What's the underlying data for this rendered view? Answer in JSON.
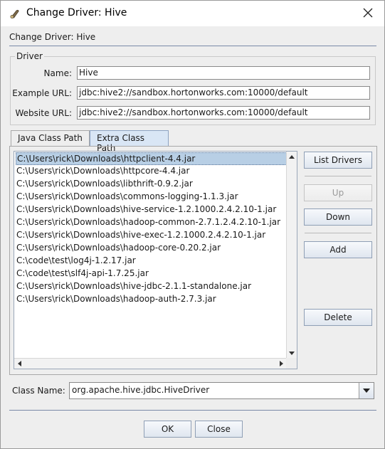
{
  "window": {
    "title": "Change Driver: Hive",
    "subtitle": "Change Driver: Hive"
  },
  "driver_group": {
    "title": "Driver",
    "name_label": "Name:",
    "name_value": "Hive",
    "example_url_label": "Example URL:",
    "example_url_value": "jdbc:hive2://sandbox.hortonworks.com:10000/default",
    "website_url_label": "Website URL:",
    "website_url_value": "jdbc:hive2://sandbox.hortonworks.com:10000/default"
  },
  "tabs": [
    {
      "label": "Java Class Path",
      "active": false
    },
    {
      "label": "Extra Class Path",
      "active": true
    }
  ],
  "class_path_list": {
    "selected_index": 0,
    "items": [
      "C:\\Users\\rick\\Downloads\\httpclient-4.4.jar",
      "C:\\Users\\rick\\Downloads\\httpcore-4.4.jar",
      "C:\\Users\\rick\\Downloads\\libthrift-0.9.2.jar",
      "C:\\Users\\rick\\Downloads\\commons-logging-1.1.3.jar",
      "C:\\Users\\rick\\Downloads\\hive-service-1.2.1000.2.4.2.10-1.jar",
      "C:\\Users\\rick\\Downloads\\hadoop-common-2.7.1.2.4.2.10-1.jar",
      "C:\\Users\\rick\\Downloads\\hive-exec-1.2.1000.2.4.2.10-1.jar",
      "C:\\Users\\rick\\Downloads\\hadoop-core-0.20.2.jar",
      "C:\\code\\test\\log4j-1.2.17.jar",
      "C:\\code\\test\\slf4j-api-1.7.25.jar",
      "C:\\Users\\rick\\Downloads\\hive-jdbc-2.1.1-standalone.jar",
      "C:\\Users\\rick\\Downloads\\hadoop-auth-2.7.3.jar"
    ]
  },
  "side_buttons": {
    "list_drivers": "List Drivers",
    "up": "Up",
    "down": "Down",
    "add": "Add",
    "delete": "Delete"
  },
  "class_name": {
    "label": "Class Name:",
    "value": "org.apache.hive.jdbc.HiveDriver"
  },
  "footer": {
    "ok": "OK",
    "close": "Close"
  },
  "icons": {
    "app": "gear-icon",
    "close": "close-icon",
    "scroll_up": "arrow-up-icon",
    "scroll_down": "arrow-down-icon",
    "scroll_left": "arrow-left-icon",
    "scroll_right": "arrow-right-icon",
    "dropdown": "chevron-down-icon"
  },
  "colors": {
    "selection": "#b8cfe5",
    "active_tab": "#d9e6f5",
    "button_border": "#8f9fb5"
  }
}
